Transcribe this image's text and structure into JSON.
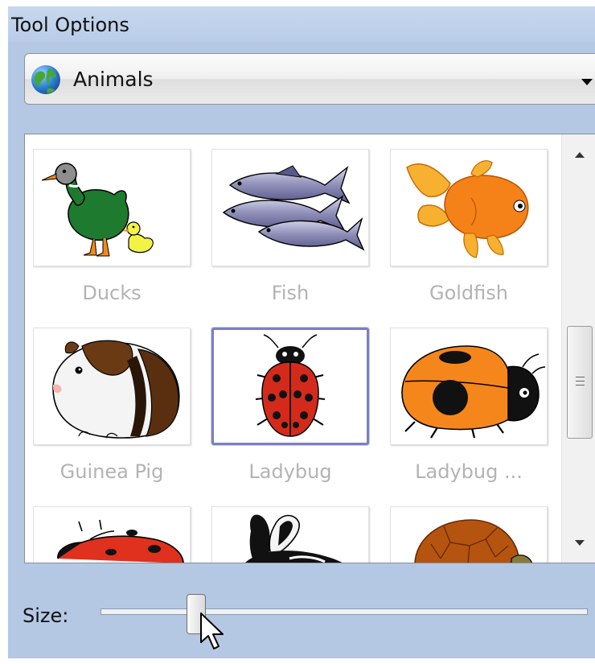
{
  "panel": {
    "title": "Tool Options"
  },
  "category": {
    "selected": "Animals",
    "icon": "globe-icon"
  },
  "gallery": {
    "items": [
      {
        "label": "Ducks",
        "icon": "ducks-image"
      },
      {
        "label": "Fish",
        "icon": "fish-image"
      },
      {
        "label": "Goldfish",
        "icon": "goldfish-image"
      },
      {
        "label": "Guinea Pig",
        "icon": "guinea-pig-image"
      },
      {
        "label": "Ladybug",
        "icon": "ladybug-image"
      },
      {
        "label": "Ladybug ...",
        "icon": "ladybug-orange-image"
      },
      {
        "label": "",
        "icon": "ladybug-red-image"
      },
      {
        "label": "",
        "icon": "rabbit-image"
      },
      {
        "label": "",
        "icon": "tortoise-image"
      }
    ],
    "selected_index": 4
  },
  "size": {
    "label": "Size:",
    "value_fraction": 0.2
  },
  "colors": {
    "panel_bg": "#b4c8e4",
    "selection_border": "#7a7fc4",
    "label_disabled": "#b3b3b3"
  }
}
